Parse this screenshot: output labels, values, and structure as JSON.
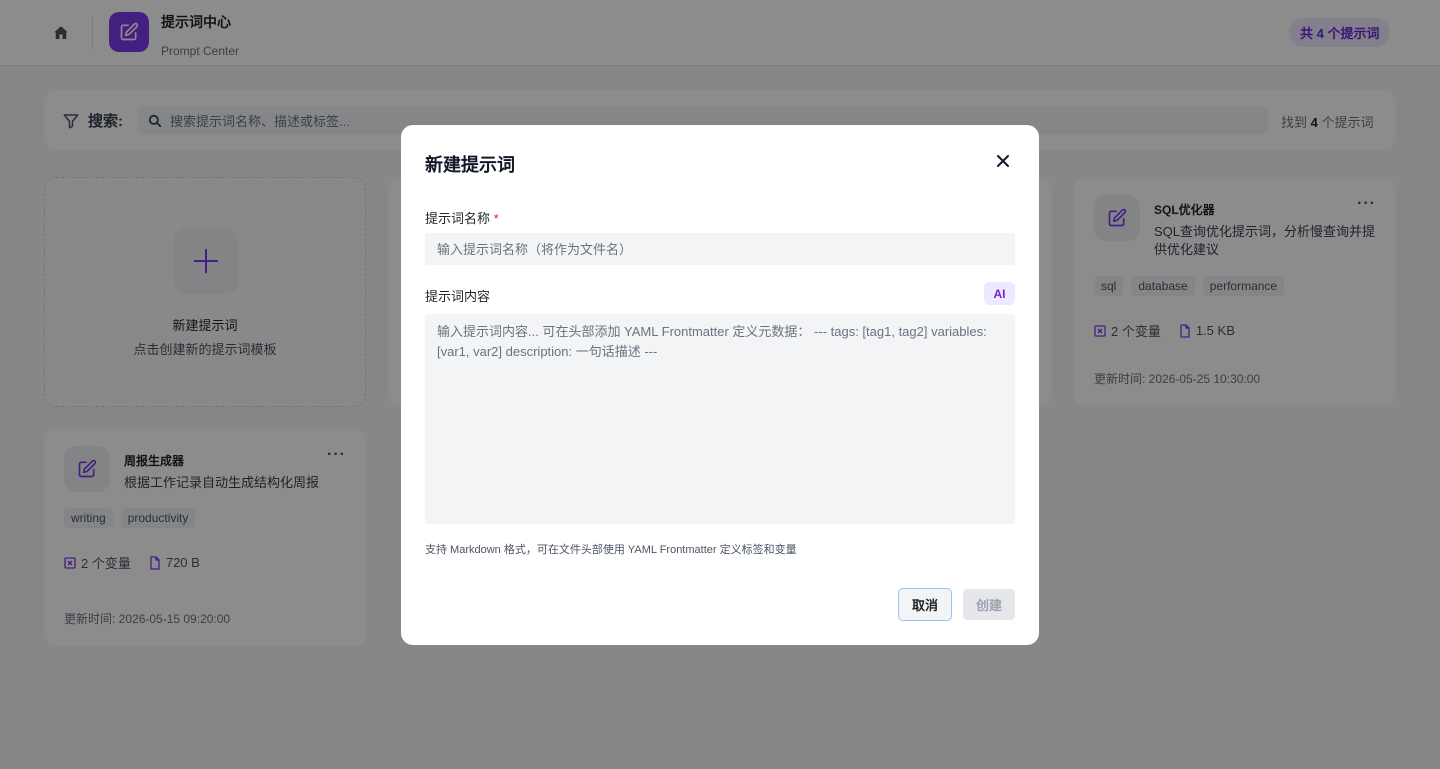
{
  "header": {
    "home_icon": "home-icon",
    "app_icon": "edit-square-icon",
    "title": "提示词中心",
    "subtitle": "Prompt Center",
    "count_badge": "共 4 个提示词"
  },
  "search": {
    "label": "搜索:",
    "placeholder": "搜索提示词名称、描述或标签...",
    "result_prefix": "找到",
    "result_count": "4",
    "result_suffix": "个提示词"
  },
  "new_card": {
    "title": "新建提示词",
    "description": "点击创建新的提示词模板"
  },
  "cards": [
    {
      "name": "SQL优化器",
      "description": "SQL查询优化提示词，分析慢查询并提供优化建议",
      "tags": [
        "sql",
        "database",
        "performance"
      ],
      "variables": "2 个变量",
      "size": "1.5 KB",
      "updated": "更新时间: 2026-05-25 10:30:00"
    },
    {
      "name": "周报生成器",
      "description": "根据工作记录自动生成结构化周报",
      "tags": [
        "writing",
        "productivity"
      ],
      "variables": "2 个变量",
      "size": "720 B",
      "updated": "更新时间: 2026-05-15 09:20:00"
    }
  ],
  "modal": {
    "title": "新建提示词",
    "name_label": "提示词名称",
    "required_mark": "*",
    "name_value": "",
    "name_placeholder": "输入提示词名称（将作为文件名）",
    "content_label": "提示词内容",
    "ai_button": "AI",
    "content_value": "",
    "content_placeholder": "输入提示词内容... 可在头部添加 YAML Frontmatter 定义元数据： --- tags: [tag1, tag2] variables: [var1, var2] description: 一句话描述 ---",
    "hint": "支持 Markdown 格式，可在文件头部使用 YAML Frontmatter 定义标签和变量",
    "cancel_button": "取消",
    "create_button": "创建"
  },
  "colors": {
    "accent": "#7c3aed",
    "accent_light": "#ede9fe",
    "overlay": "rgba(0,0,0,0.45)"
  }
}
